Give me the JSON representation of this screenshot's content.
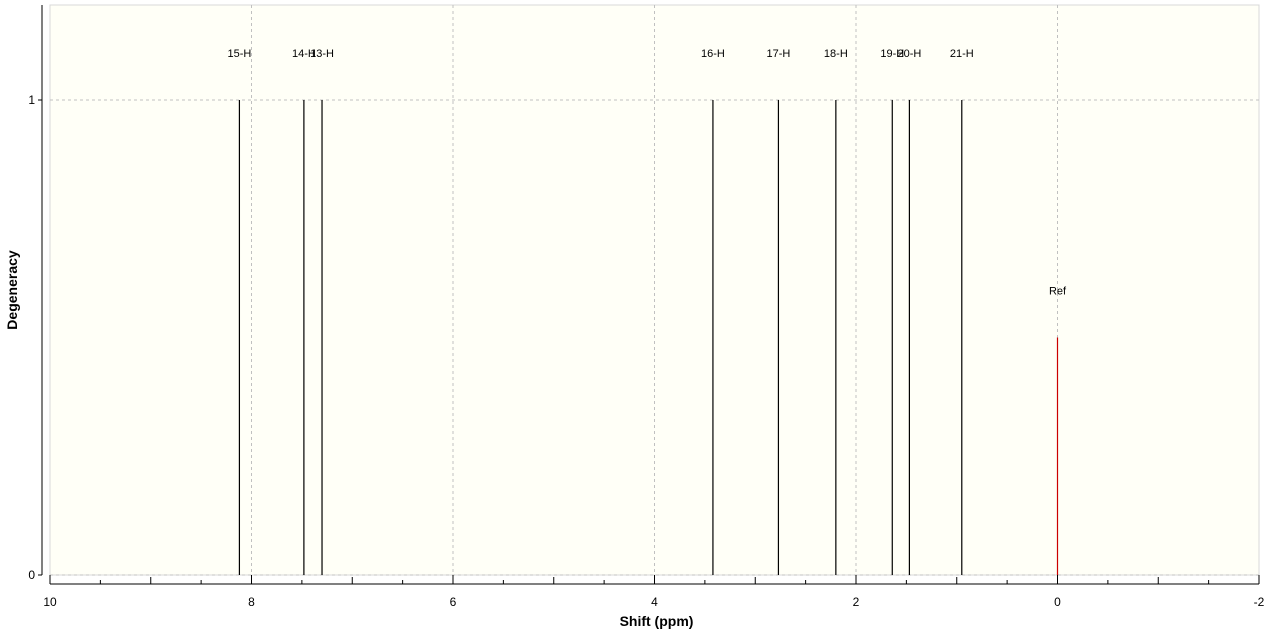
{
  "chart_data": {
    "type": "bar",
    "title": "",
    "xlabel": "Shift (ppm)",
    "ylabel": "Degeneracy",
    "xlim": [
      10,
      -2
    ],
    "ylim": [
      0,
      1.2
    ],
    "x_reversed": true,
    "x_ticks": [
      {
        "value": 10,
        "label": "10"
      },
      {
        "value": 8,
        "label": "8"
      },
      {
        "value": 6,
        "label": "6"
      },
      {
        "value": 4,
        "label": "4"
      },
      {
        "value": 2,
        "label": "2"
      },
      {
        "value": 0,
        "label": "0"
      },
      {
        "value": -2,
        "label": "-2"
      }
    ],
    "y_ticks": [
      {
        "value": 0,
        "label": "0"
      },
      {
        "value": 1,
        "label": "1"
      }
    ],
    "grid": true,
    "series": [
      {
        "points": [
          {
            "label": "15-H",
            "x": 8.12,
            "y": 1
          },
          {
            "label": "14-H",
            "x": 7.48,
            "y": 1
          },
          {
            "label": "13-H",
            "x": 7.3,
            "y": 1
          },
          {
            "label": "16-H",
            "x": 3.42,
            "y": 1
          },
          {
            "label": "17-H",
            "x": 2.77,
            "y": 1
          },
          {
            "label": "18-H",
            "x": 2.2,
            "y": 1
          },
          {
            "label": "19-H",
            "x": 1.64,
            "y": 1
          },
          {
            "label": "20-H",
            "x": 1.47,
            "y": 1
          },
          {
            "label": "21-H",
            "x": 0.95,
            "y": 1
          }
        ],
        "color": "#000000"
      },
      {
        "points": [
          {
            "label": "Ref",
            "x": 0,
            "y": 0.5
          }
        ],
        "color": "#cc0000"
      }
    ],
    "colors": {
      "plot_background": "#fffff7",
      "grid": "#c0c0c0",
      "axis": "#000000"
    }
  }
}
